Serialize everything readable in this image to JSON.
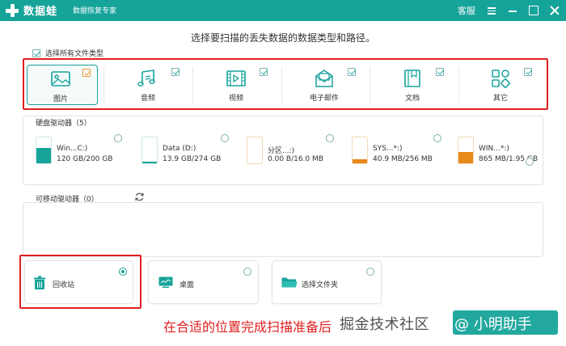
{
  "app": {
    "name": "数据蛙",
    "subtitle": "数据恢复专家"
  },
  "titlebar": {
    "service": "客服"
  },
  "heading": "选择要扫描的丢失数据的数据类型和路径。",
  "select_all_label": "选择所有文件类型",
  "file_types": [
    {
      "label": "图片",
      "icon": "image-icon",
      "checked": true,
      "selected": true
    },
    {
      "label": "音频",
      "icon": "music-icon",
      "checked": true
    },
    {
      "label": "视频",
      "icon": "video-icon",
      "checked": true
    },
    {
      "label": "电子邮件",
      "icon": "email-icon",
      "checked": true
    },
    {
      "label": "文档",
      "icon": "document-icon",
      "checked": true
    },
    {
      "label": "其它",
      "icon": "other-icon",
      "checked": true
    }
  ],
  "hard_drives": {
    "title": "硬盘驱动器（5）",
    "items": [
      {
        "name": "Win...C:)",
        "size": "120 GB/200 GB",
        "fill_fraction": 0.6,
        "fill_color": "#16a39a"
      },
      {
        "name": "Data (D:)",
        "size": "13.9 GB/274 GB",
        "fill_fraction": 0.05,
        "fill_color": "#16a39a"
      },
      {
        "name": "分区...:)",
        "size": "0.00  B/16.0 MB",
        "fill_fraction": 0.0,
        "fill_color": "#e79a3a"
      },
      {
        "name": "SYS...*:)",
        "size": "40.9 MB/256 MB",
        "fill_fraction": 0.16,
        "fill_color": "#e8891c"
      },
      {
        "name": "WIN...*:)",
        "size": "865 MB/1.95 GB",
        "fill_fraction": 0.44,
        "fill_color": "#e8891c"
      }
    ]
  },
  "removable_drives": {
    "title": "可移动驱动器（0）"
  },
  "locations": [
    {
      "label": "回收站",
      "icon": "trash-icon",
      "selected": true
    },
    {
      "label": "桌面",
      "icon": "desktop-icon",
      "selected": false
    },
    {
      "label": "选择文件夹",
      "icon": "folder-icon",
      "selected": false
    }
  ],
  "instruction": "在合适的位置完成扫描准备后",
  "watermark": {
    "text": "掘金技术社区",
    "handle": "@ 小明助手"
  },
  "colors": {
    "accent": "#16a39a",
    "highlight": "#e02020",
    "warning": "#e8891c"
  }
}
